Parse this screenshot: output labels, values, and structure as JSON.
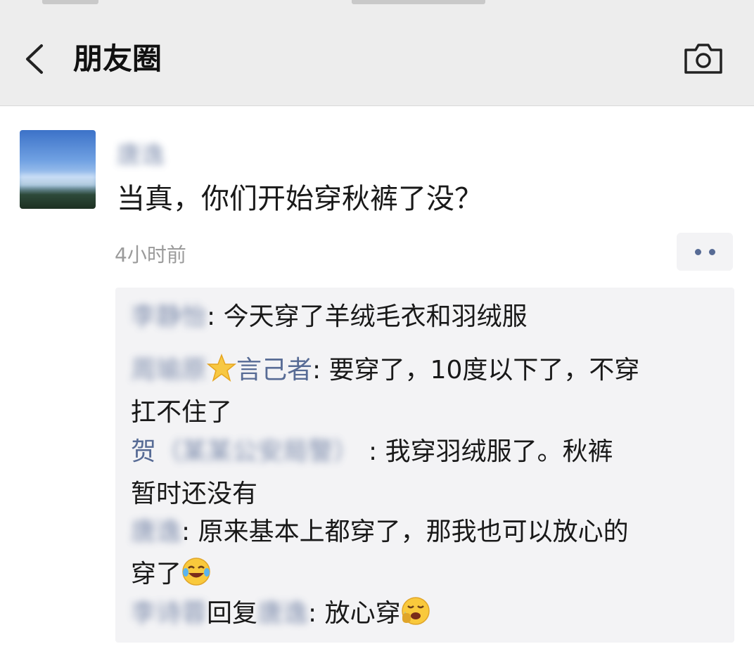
{
  "header": {
    "title": "朋友圈",
    "back_icon": "chevron-left-icon",
    "camera_icon": "camera-icon"
  },
  "post": {
    "author": "唐逸",
    "text": "当真，你们开始穿秋裤了没？",
    "time": "4小时前",
    "more_icon": "more-dots-icon"
  },
  "comments": [
    {
      "name": "李静怡",
      "text": ": 今天穿了羊绒毛衣和羽绒服"
    },
    {
      "name_blur": "周瑜原",
      "name_tail": "言己者",
      "text": ": 要穿了，10度以下了，不穿",
      "text2": "扛不住了"
    },
    {
      "name": "贺",
      "name_blur": "（某某公安局警）",
      "text": ": 我穿羽绒服了。秋裤",
      "text2": "暂时还没有"
    },
    {
      "name": "唐逸",
      "text": ": 原来基本上都穿了，那我也可以放心的",
      "text2": "穿了"
    },
    {
      "name": "李诗蓉",
      "reply_label": "回复",
      "reply_to": "唐逸",
      "text": ": 放心穿"
    }
  ],
  "colors": {
    "link": "#576b95",
    "header_bg": "#ededed",
    "comment_bg": "#f3f3f5",
    "text": "#191919",
    "muted": "#9b9b9b"
  }
}
